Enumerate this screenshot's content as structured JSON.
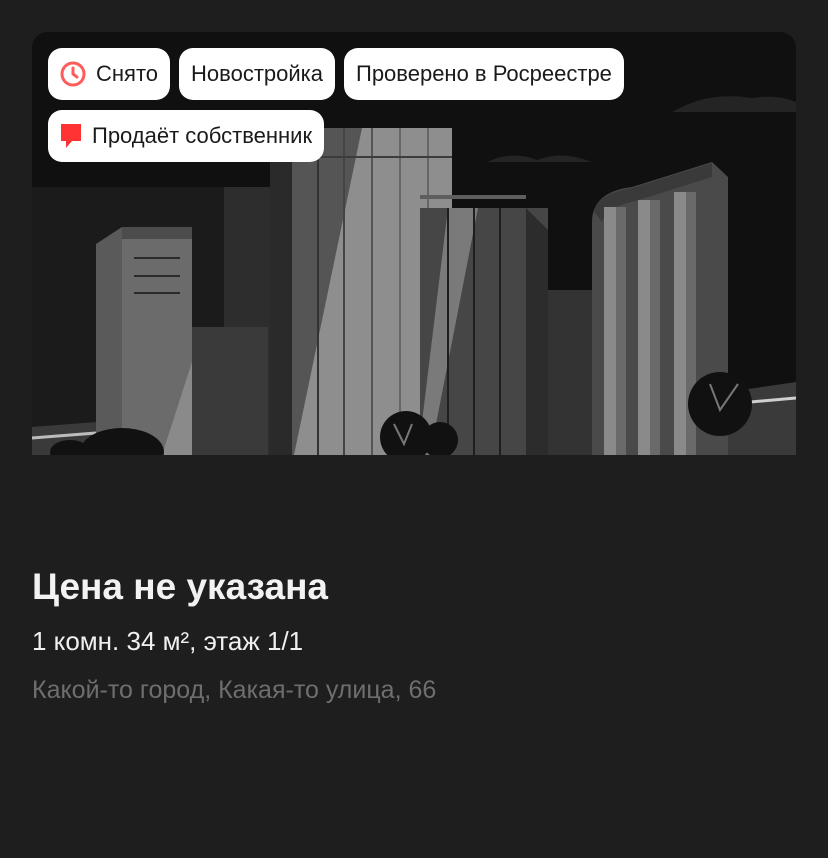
{
  "listing": {
    "image_label": "city-illustration",
    "badges": [
      {
        "label": "Снято",
        "icon": "clock-icon",
        "icon_color": "#ff5c5c"
      },
      {
        "label": "Новостройка"
      },
      {
        "label": "Проверено в Росреестре"
      },
      {
        "label": "Продаёт собственник",
        "icon": "flag-icon",
        "icon_color": "#ff3333"
      }
    ],
    "price": "Цена не указана",
    "params": "1 комн. 34 м², этаж 1/1",
    "address": "Какой-то город, Какая-то улица, 66"
  },
  "colors": {
    "background": "#1e1e1e",
    "badge_bg": "#ffffff",
    "price_text": "#f2f2f2",
    "address_text": "#6e6e6e"
  }
}
